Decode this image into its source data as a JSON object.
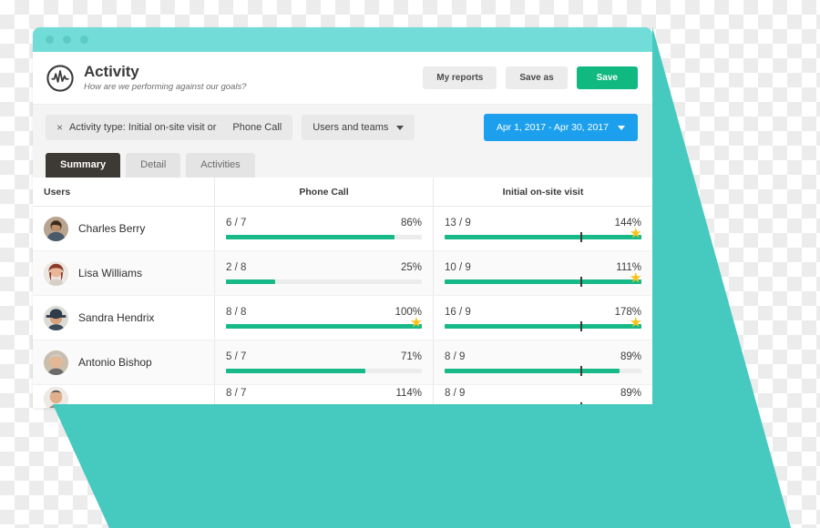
{
  "window": {
    "titlebar_dots": 3,
    "titlebar_color": "#72ddd8"
  },
  "header": {
    "logo_name": "activity-pulse-logo",
    "title": "Activity",
    "subtitle": "How are we performing against our goals?",
    "actions": [
      {
        "label": "My reports",
        "style": "grey"
      },
      {
        "label": "Save as",
        "style": "grey"
      },
      {
        "label": "Save",
        "style": "green"
      }
    ]
  },
  "filters": {
    "activity_chip": {
      "remove_glyph": "×",
      "label": "Activity type: Initial on-site visit or",
      "value": "Phone Call"
    },
    "users_chip": {
      "label": "Users and teams"
    },
    "date_range": {
      "label": "Apr 1, 2017 - Apr 30, 2017",
      "color": "#1ca0ee"
    }
  },
  "tabs": [
    {
      "label": "Summary",
      "active": true
    },
    {
      "label": "Detail",
      "active": false
    },
    {
      "label": "Activities",
      "active": false
    }
  ],
  "table": {
    "columns": [
      "Users",
      "Phone Call",
      "Initial on-site visit"
    ],
    "rows": [
      {
        "user": "Charles Berry",
        "avatar": "avatar-charles-berry",
        "metrics": [
          {
            "ratio": "6 / 7",
            "percent": "86%",
            "fill": 86,
            "goal": null,
            "star": false
          },
          {
            "ratio": "13 / 9",
            "percent": "144%",
            "fill": 100,
            "goal": 69,
            "star": true
          }
        ]
      },
      {
        "user": "Lisa Williams",
        "avatar": "avatar-lisa-williams",
        "metrics": [
          {
            "ratio": "2 / 8",
            "percent": "25%",
            "fill": 25,
            "goal": null,
            "star": false
          },
          {
            "ratio": "10 / 9",
            "percent": "111%",
            "fill": 100,
            "goal": 69,
            "star": true
          }
        ]
      },
      {
        "user": "Sandra Hendrix",
        "avatar": "avatar-sandra-hendrix",
        "metrics": [
          {
            "ratio": "8 / 8",
            "percent": "100%",
            "fill": 100,
            "goal": null,
            "star": true
          },
          {
            "ratio": "16 / 9",
            "percent": "178%",
            "fill": 100,
            "goal": 69,
            "star": true
          }
        ]
      },
      {
        "user": "Antonio Bishop",
        "avatar": "avatar-antonio-bishop",
        "metrics": [
          {
            "ratio": "5 / 7",
            "percent": "71%",
            "fill": 71,
            "goal": null,
            "star": false
          },
          {
            "ratio": "8 / 9",
            "percent": "89%",
            "fill": 89,
            "goal": 69,
            "star": false
          }
        ]
      },
      {
        "user": "",
        "avatar": "avatar-next-user",
        "metrics": [
          {
            "ratio": "8 / 7",
            "percent": "114%",
            "fill": 100,
            "goal": null,
            "star": false
          },
          {
            "ratio": "8 / 9",
            "percent": "89%",
            "fill": 89,
            "goal": 69,
            "star": false
          }
        ]
      }
    ]
  },
  "decoration": {
    "teal_color": "#46c9bf",
    "accent_green": "#0fb97f",
    "bar_green": "#16b987",
    "star_yellow": "#f7c41c"
  }
}
